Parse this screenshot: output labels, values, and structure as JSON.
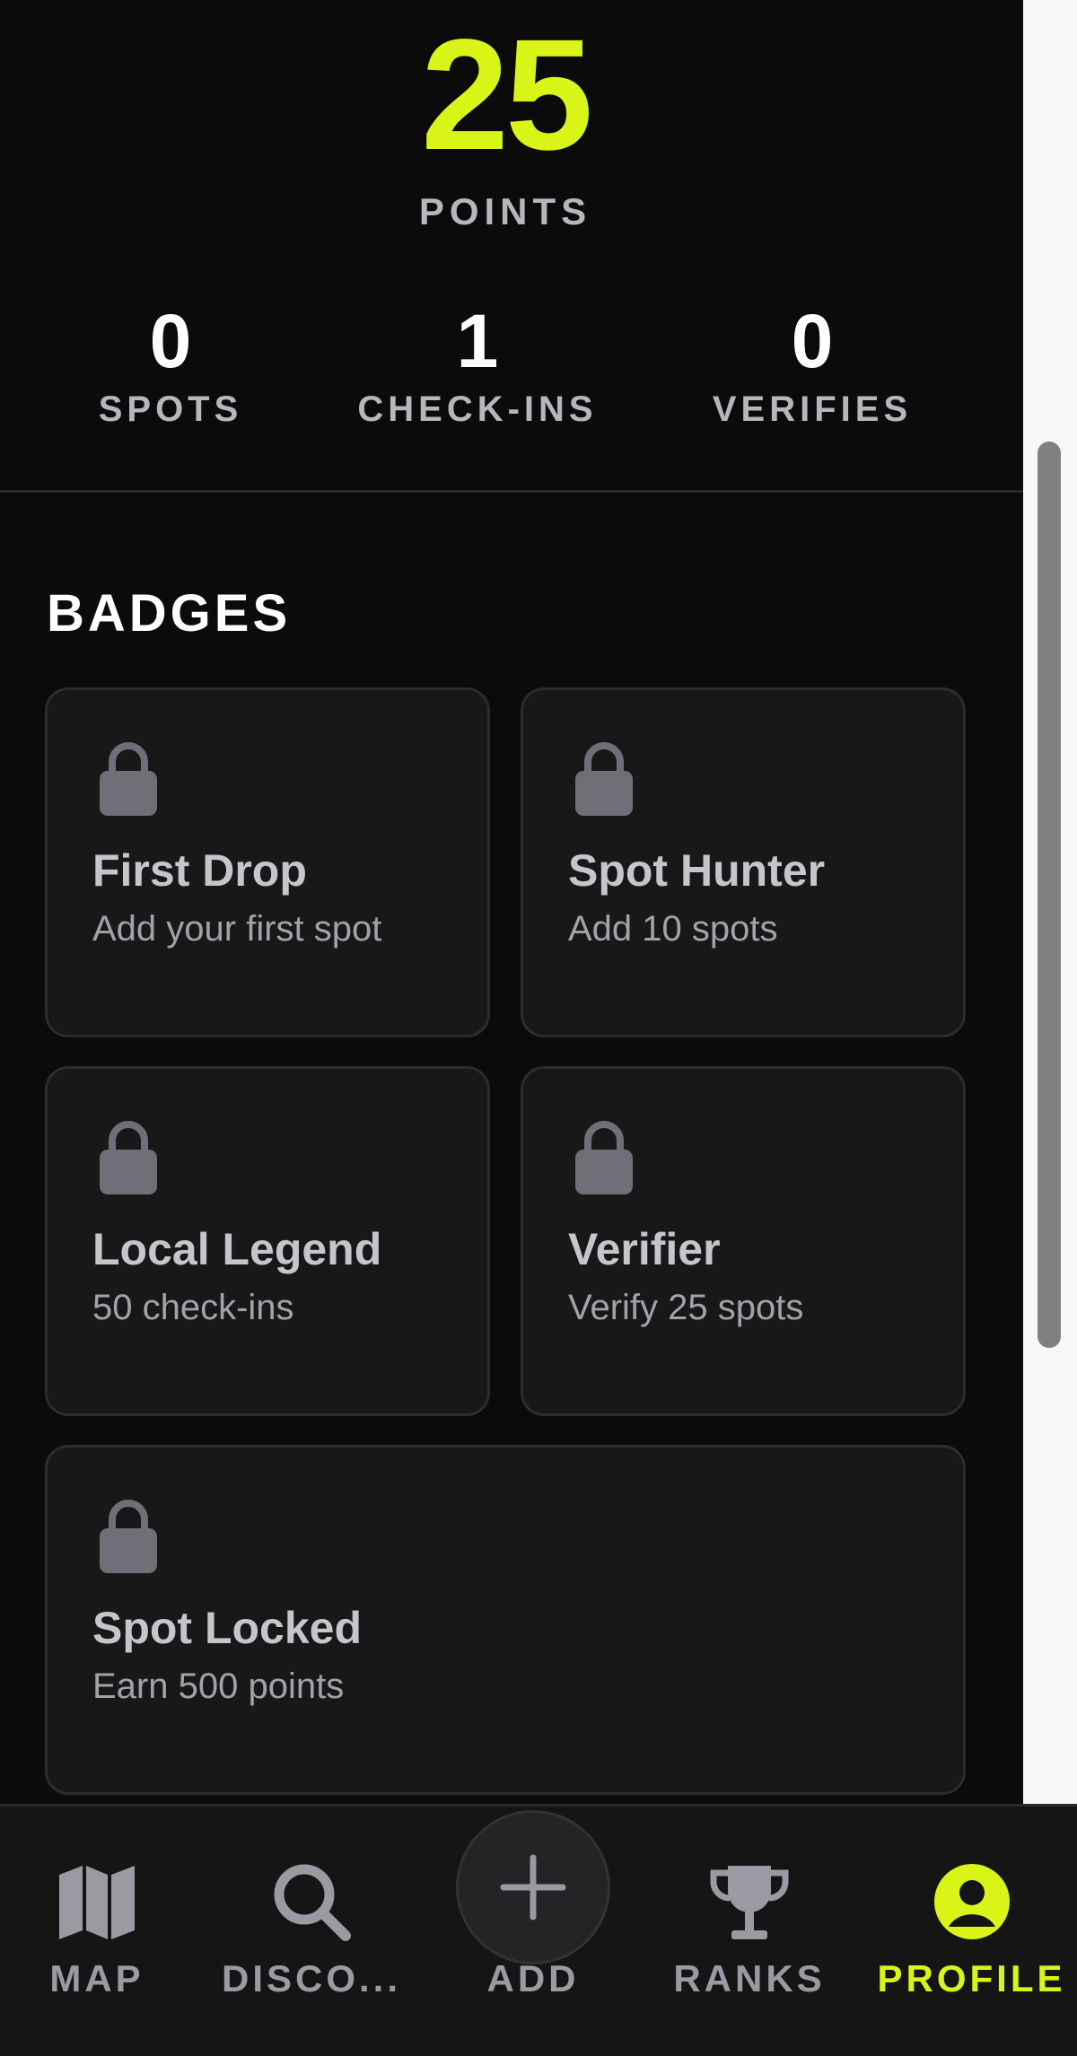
{
  "score": {
    "value": "25",
    "label": "POINTS"
  },
  "stats": [
    {
      "value": "0",
      "label": "SPOTS"
    },
    {
      "value": "1",
      "label": "CHECK-INS"
    },
    {
      "value": "0",
      "label": "VERIFIES"
    }
  ],
  "badges": {
    "heading": "BADGES",
    "items": [
      {
        "name": "First Drop",
        "desc": "Add your first spot",
        "icon": "lock-icon",
        "locked": true
      },
      {
        "name": "Spot Hunter",
        "desc": "Add 10 spots",
        "icon": "lock-icon",
        "locked": true
      },
      {
        "name": "Local Legend",
        "desc": "50 check-ins",
        "icon": "lock-icon",
        "locked": true
      },
      {
        "name": "Verifier",
        "desc": "Verify 25 spots",
        "icon": "lock-icon",
        "locked": true
      },
      {
        "name": "Spot Locked",
        "desc": "Earn 500 points",
        "icon": "lock-icon",
        "locked": true
      }
    ]
  },
  "nav": {
    "items": [
      {
        "label": "MAP",
        "icon": "map-icon"
      },
      {
        "label": "DISCO...",
        "icon": "search-icon"
      },
      {
        "label": "ADD",
        "icon": "plus-icon"
      },
      {
        "label": "RANKS",
        "icon": "trophy-icon"
      },
      {
        "label": "PROFILE",
        "icon": "user-icon",
        "active": true
      }
    ]
  },
  "colors": {
    "accent": "#d9f417",
    "background": "#0b0b0c",
    "card": "#181819",
    "muted": "#9a9aa2"
  }
}
